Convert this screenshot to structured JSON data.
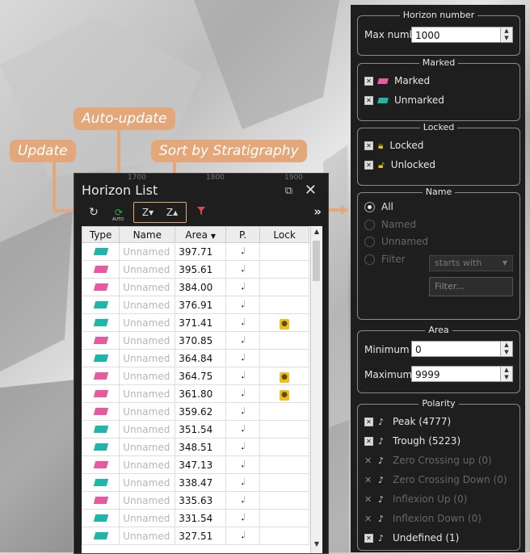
{
  "callouts": {
    "update": "Update",
    "auto_update": "Auto-update",
    "sort_by_strat": "Sort by Stratigraphy"
  },
  "ruler": {
    "t1": "1700",
    "t2": "1800",
    "t3": "1900"
  },
  "horizon_list": {
    "title": "Horizon List",
    "toolbar": {
      "update_icon": "refresh-icon",
      "auto_update_label": "AUTO",
      "sort_down_label": "Z▾",
      "sort_up_label": "Z▴",
      "filter_icon": "filter-clear-icon",
      "more": "»"
    },
    "columns": [
      "Type",
      "Name",
      "Area",
      "P.",
      "Lock"
    ],
    "sort_indicator": "▼",
    "rows": [
      {
        "type": "unmarked",
        "name": "Unnamed",
        "area": "397.71",
        "locked": false
      },
      {
        "type": "marked",
        "name": "Unnamed",
        "area": "395.61",
        "locked": false
      },
      {
        "type": "marked",
        "name": "Unnamed",
        "area": "384.00",
        "locked": false
      },
      {
        "type": "unmarked",
        "name": "Unnamed",
        "area": "376.91",
        "locked": false
      },
      {
        "type": "unmarked",
        "name": "Unnamed",
        "area": "371.41",
        "locked": true
      },
      {
        "type": "marked",
        "name": "Unnamed",
        "area": "370.85",
        "locked": false
      },
      {
        "type": "unmarked",
        "name": "Unnamed",
        "area": "364.84",
        "locked": false
      },
      {
        "type": "marked",
        "name": "Unnamed",
        "area": "364.75",
        "locked": true
      },
      {
        "type": "marked",
        "name": "Unnamed",
        "area": "361.80",
        "locked": true
      },
      {
        "type": "marked",
        "name": "Unnamed",
        "area": "359.62",
        "locked": false
      },
      {
        "type": "unmarked",
        "name": "Unnamed",
        "area": "351.54",
        "locked": false
      },
      {
        "type": "unmarked",
        "name": "Unnamed",
        "area": "348.51",
        "locked": false
      },
      {
        "type": "marked",
        "name": "Unnamed",
        "area": "347.13",
        "locked": false
      },
      {
        "type": "unmarked",
        "name": "Unnamed",
        "area": "338.47",
        "locked": false
      },
      {
        "type": "marked",
        "name": "Unnamed",
        "area": "335.63",
        "locked": false
      },
      {
        "type": "unmarked",
        "name": "Unnamed",
        "area": "331.54",
        "locked": false
      },
      {
        "type": "unmarked",
        "name": "Unnamed",
        "area": "327.51",
        "locked": false
      }
    ]
  },
  "filters": {
    "horizon_number": {
      "title": "Horizon number",
      "label": "Max number",
      "value": "1000"
    },
    "marked": {
      "title": "Marked",
      "items": [
        "Marked",
        "Unmarked"
      ]
    },
    "locked": {
      "title": "Locked",
      "items": [
        "Locked",
        "Unlocked"
      ]
    },
    "name": {
      "title": "Name",
      "options": [
        "All",
        "Named",
        "Unnamed",
        "Filter"
      ],
      "selected": "All",
      "match_mode": "starts with",
      "filter_placeholder": "Filter..."
    },
    "area": {
      "title": "Area",
      "min_label": "Minimum",
      "min_value": "0",
      "max_label": "Maximum",
      "max_value": "9999"
    },
    "polarity": {
      "title": "Polarity",
      "items": [
        {
          "label": "Peak (4777)",
          "enabled": true
        },
        {
          "label": "Trough (5223)",
          "enabled": true
        },
        {
          "label": "Zero Crossing up (0)",
          "enabled": false
        },
        {
          "label": "Zero Crossing Down (0)",
          "enabled": false
        },
        {
          "label": "Inflexion Up (0)",
          "enabled": false
        },
        {
          "label": "Inflexion Down (0)",
          "enabled": false
        },
        {
          "label": "Undefined (1)",
          "enabled": true
        }
      ]
    }
  },
  "colors": {
    "marked": "#e85aa0",
    "unmarked": "#1fb5a8",
    "callout": "#e3a77a",
    "lock": "#e8c020"
  }
}
